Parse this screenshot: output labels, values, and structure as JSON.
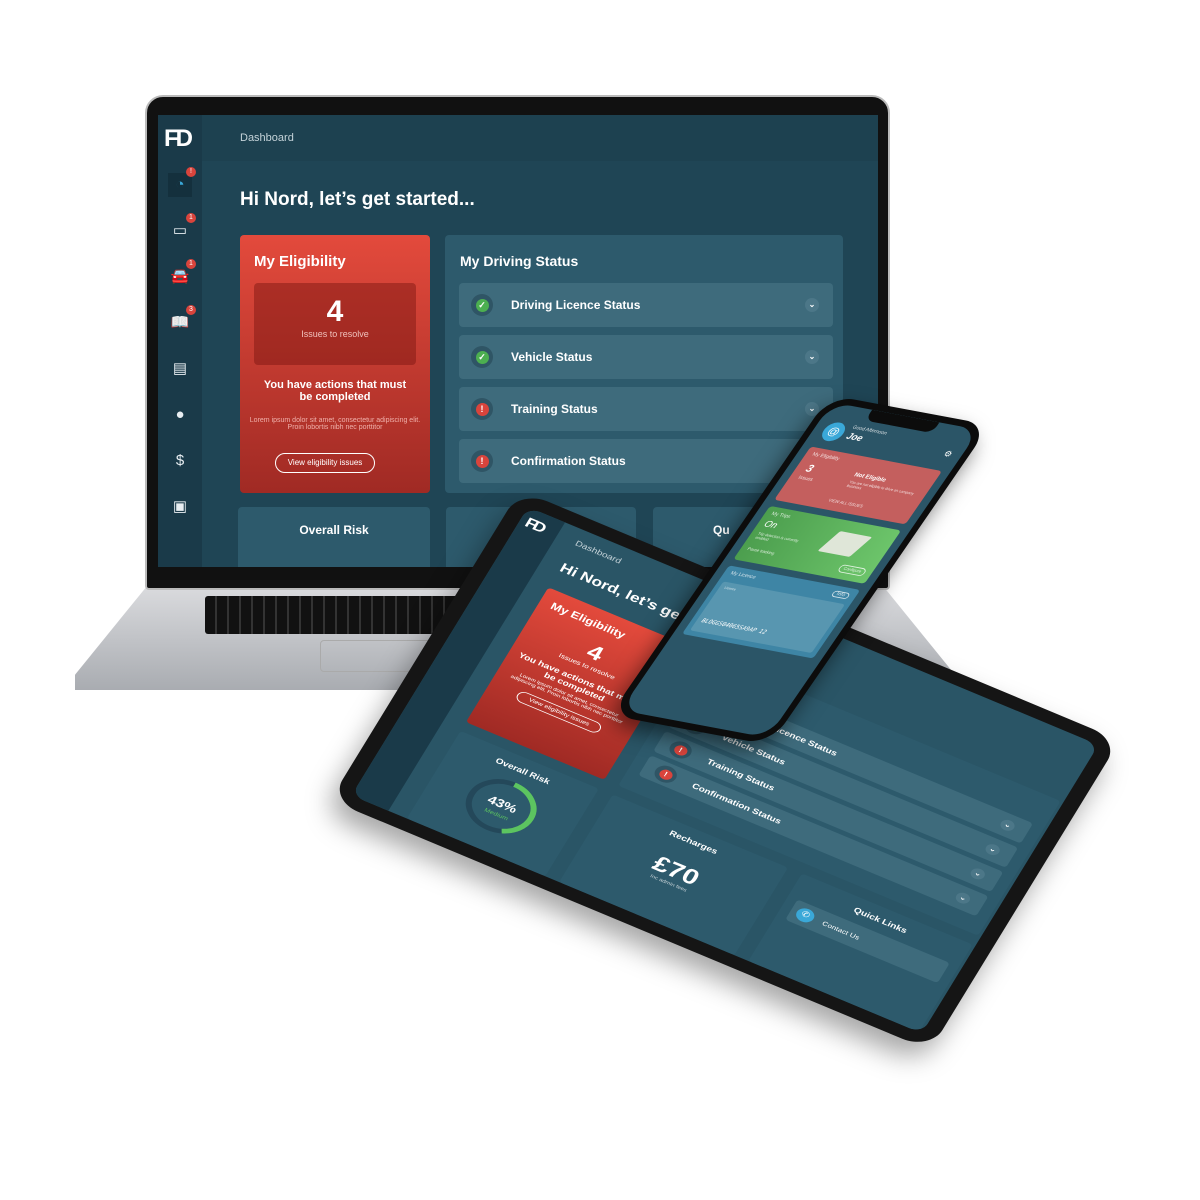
{
  "laptop": {
    "breadcrumb": "Dashboard",
    "greeting": "Hi Nord, let’s get started...",
    "sidebar": [
      {
        "icon": "speedometer-icon",
        "badge": "!"
      },
      {
        "icon": "card-icon",
        "badge": "1"
      },
      {
        "icon": "car-icon",
        "badge": "1"
      },
      {
        "icon": "book-icon",
        "badge": "3"
      },
      {
        "icon": "document-icon",
        "badge": ""
      },
      {
        "icon": "user-icon",
        "badge": ""
      },
      {
        "icon": "invoice-icon",
        "badge": ""
      },
      {
        "icon": "contact-card-icon",
        "badge": ""
      }
    ],
    "eligibility": {
      "title": "My Eligibility",
      "count": "4",
      "count_label": "Issues to resolve",
      "heading": "You have actions that must be completed",
      "body": "Lorem ipsum dolor sit amet, consectetur adipiscing elit. Proin lobortis nibh nec porttitor",
      "button": "View eligibility issues"
    },
    "driving_status": {
      "title": "My Driving Status",
      "items": [
        {
          "label": "Driving Licence Status",
          "state": "ok"
        },
        {
          "label": "Vehicle Status",
          "state": "ok"
        },
        {
          "label": "Training Status",
          "state": "error"
        },
        {
          "label": "Confirmation Status",
          "state": "error"
        }
      ]
    },
    "overall_risk": {
      "title": "Overall Risk"
    },
    "quick_links_partial": "Qu"
  },
  "tablet": {
    "breadcrumb": "Dashboard",
    "greeting": "Hi Nord, let’s get started...",
    "eligibility": {
      "title": "My Eligibility",
      "count": "4",
      "count_label": "Issues to resolve",
      "heading": "You have actions that must be completed",
      "body": "Lorem ipsum dolor sit amet, consectetur adipiscing elit. Proin lobortis nibh nec porttitor",
      "button": "View eligibility issues"
    },
    "status_items": [
      "Driving Licence Status",
      "Vehicle Status",
      "Training Status",
      "Confirmation Status"
    ],
    "overall_risk": {
      "title": "Overall Risk",
      "percent": "43%",
      "level": "Medium",
      "value": 43
    },
    "recharges": {
      "title": "Recharges",
      "amount": "£70",
      "note": "Inc admin fees"
    },
    "quick_links": {
      "title": "Quick Links",
      "items": [
        "Contact Us"
      ]
    }
  },
  "phone": {
    "greeting": "Good Afternoon",
    "name": "Joe",
    "eligibility": {
      "title": "My Eligibility",
      "count": "3",
      "count_label": "Issues",
      "status": "Not Eligible",
      "body": "You are not eligible to drive on company business",
      "link": "VIEW ALL ISSUES"
    },
    "trips": {
      "title": "My Trips",
      "state": "On",
      "body": "Trip detection is currently enabled",
      "pause": "Pause tracking",
      "button": "Configure"
    },
    "licence": {
      "title": "My Licence",
      "button": "Info",
      "label": "Licence",
      "number": "BLOGGS04065SA9AP 12"
    }
  },
  "colors": {
    "background": "#1f4555",
    "eligibility": "#e34a3c",
    "ok": "#4caf50",
    "error": "#d9443c",
    "accent": "#3aa8d8"
  }
}
